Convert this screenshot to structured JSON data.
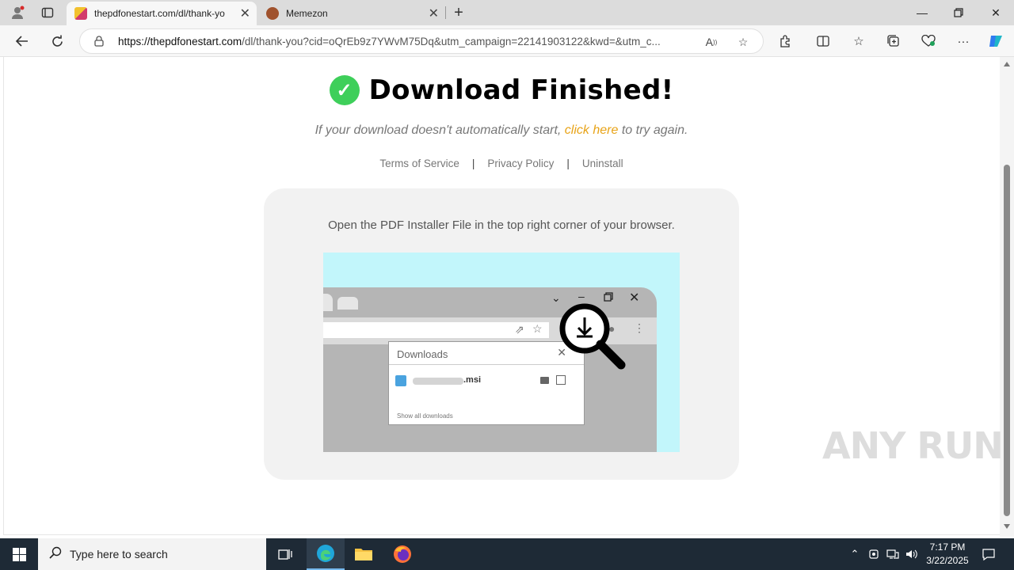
{
  "browser": {
    "tabs": [
      {
        "title": "thepdfonestart.com/dl/thank-yo",
        "active": true
      },
      {
        "title": "Memezon",
        "active": false
      }
    ],
    "url_host": "https://thepdfonestart.com",
    "url_path": "/dl/thank-you?cid=oQrEb9z7YWvM75Dq&utm_campaign=22141903122&kwd=&utm_c..."
  },
  "page": {
    "headline": "Download Finished!",
    "retry_prefix": "If your download doesn't automatically start,",
    "retry_link": "click here",
    "retry_suffix": "to try again.",
    "links": [
      "Terms of Service",
      "Privacy Policy",
      "Uninstall"
    ],
    "link_separator": "|",
    "instruction": "Open the PDF Installer File in the top right corner of your browser.",
    "illustration": {
      "downloads_title": "Downloads",
      "file_ext": ".msi",
      "show_all": "Show all downloads"
    }
  },
  "watermark": "ANY RUN",
  "taskbar": {
    "search_placeholder": "Type here to search",
    "time": "7:17 PM",
    "date": "3/22/2025"
  },
  "colors": {
    "accent_link": "#e8a317",
    "check_green": "#3ecf5a",
    "illus_bg": "#c2f6fb",
    "taskbar": "#1e2a36"
  }
}
